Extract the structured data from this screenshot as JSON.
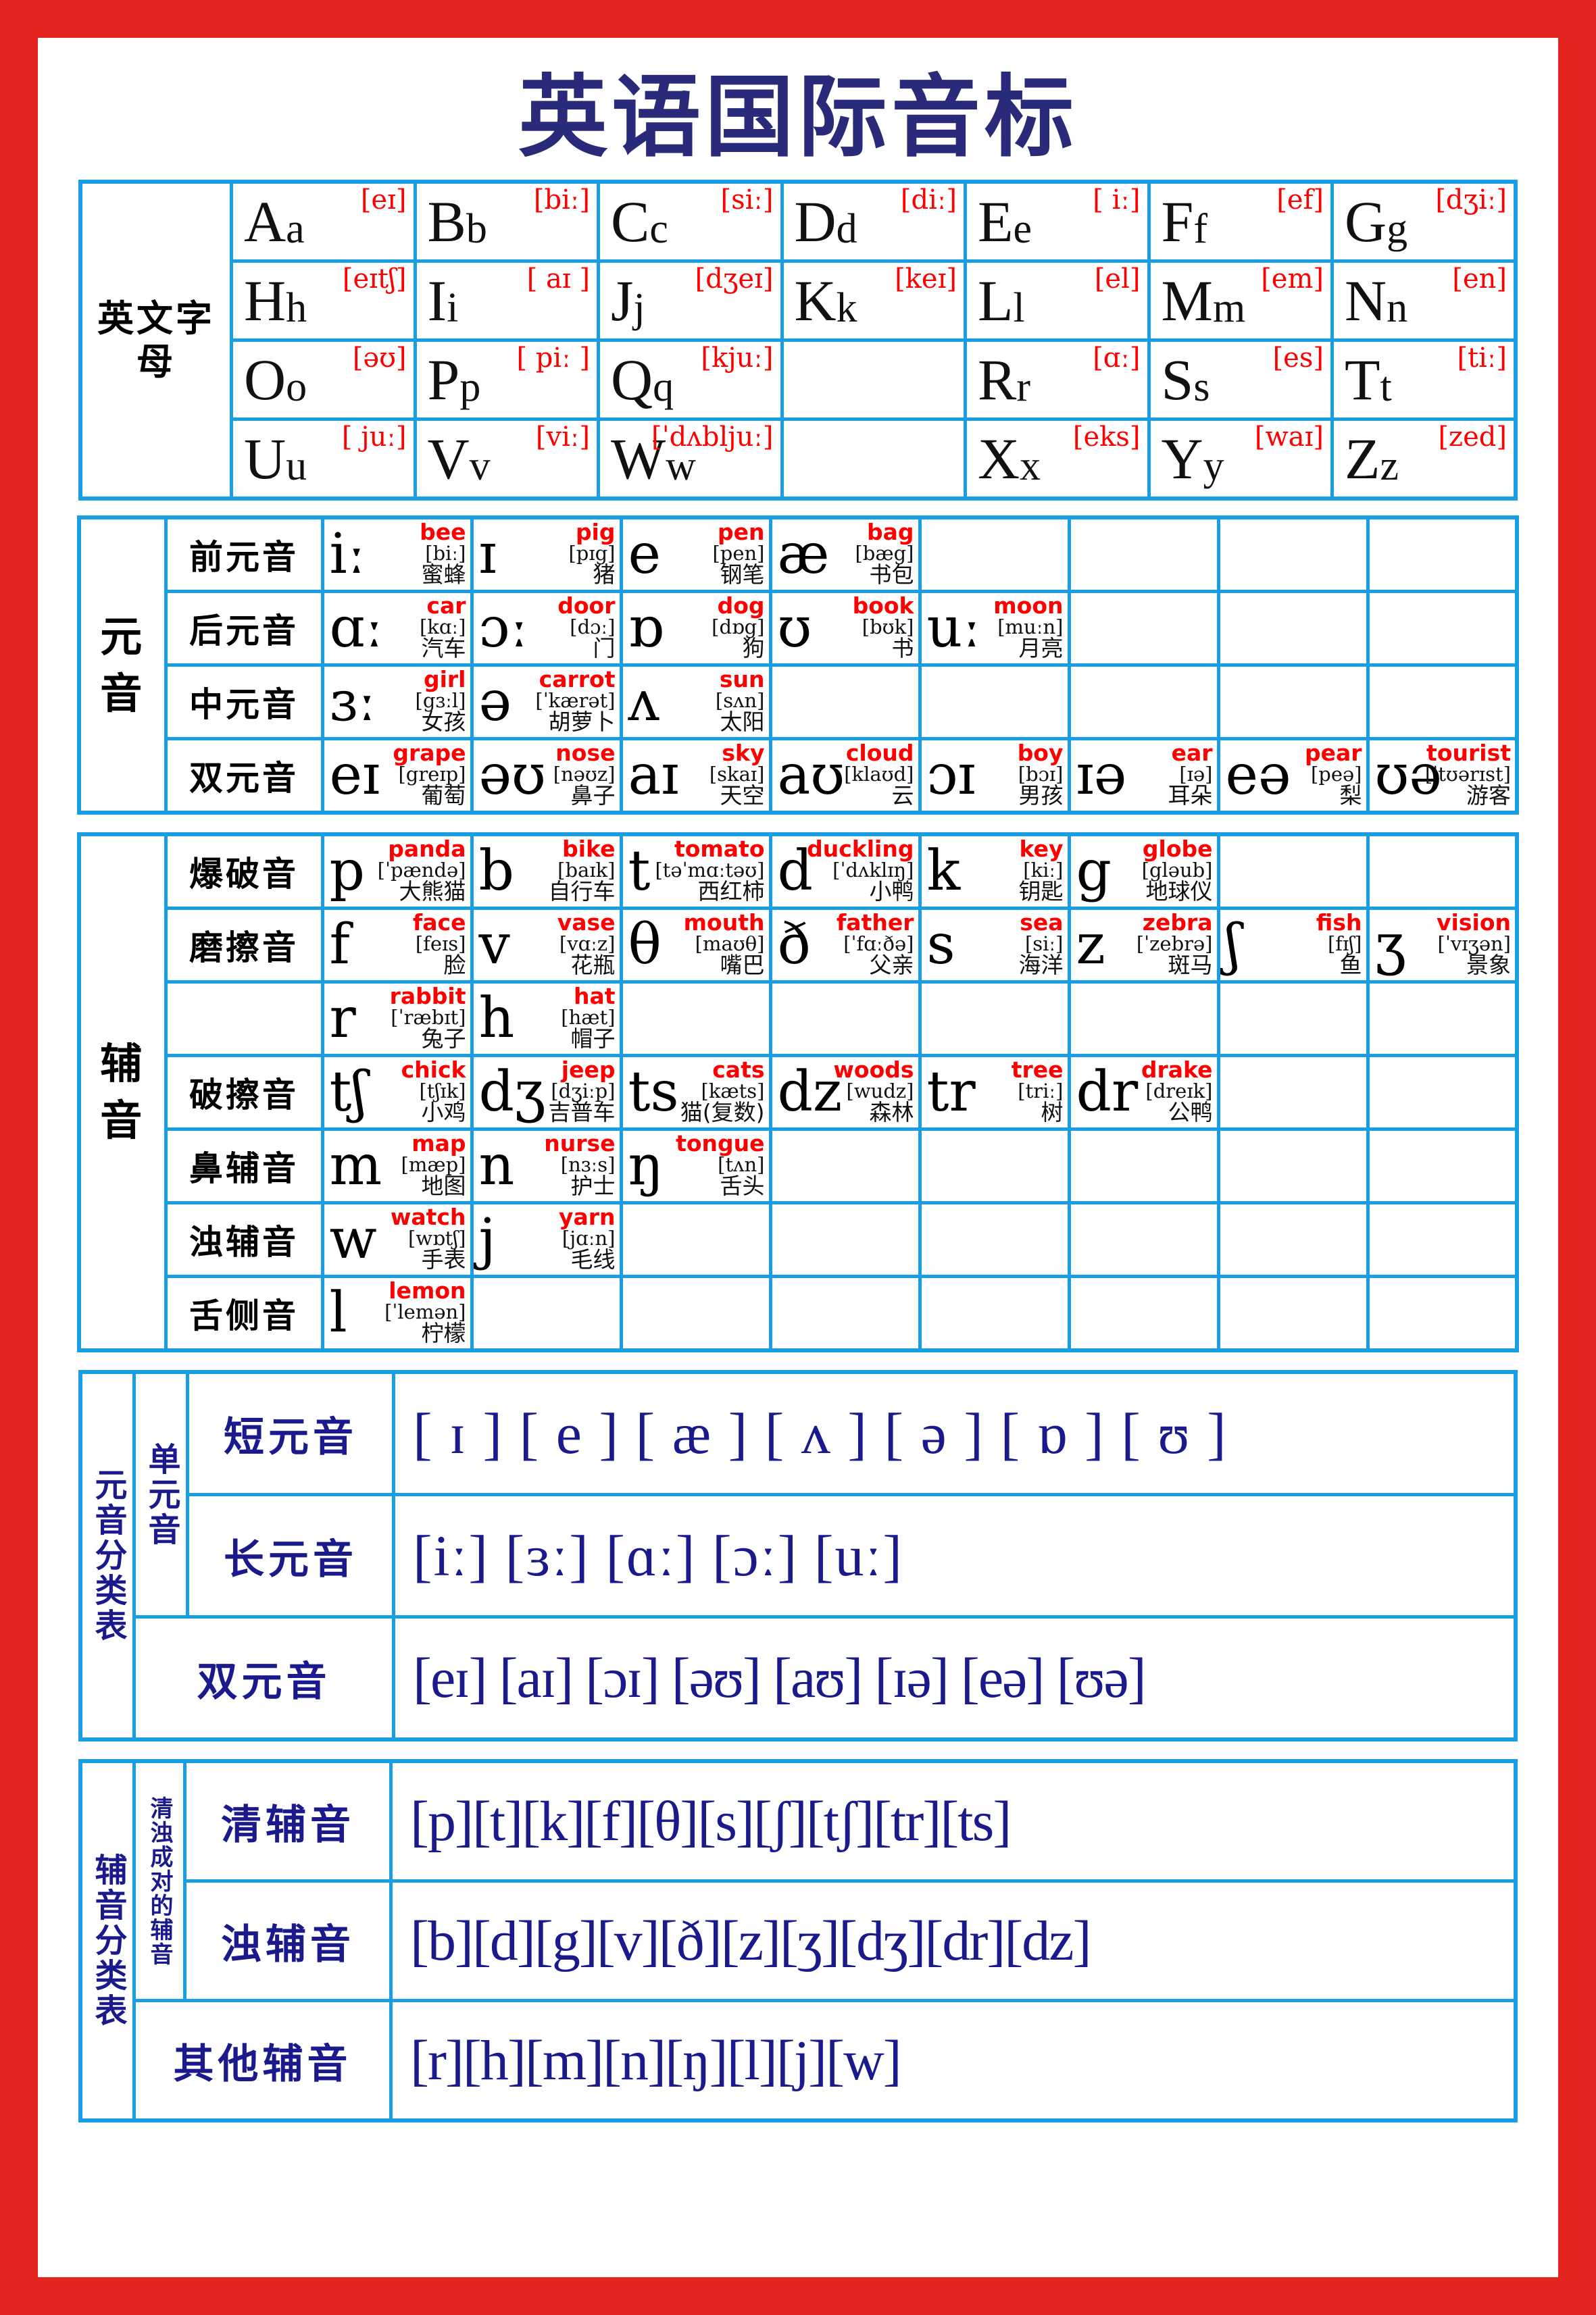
{
  "title": "英语国际音标",
  "alphabet": {
    "side_label": "英文字母",
    "rows": [
      [
        {
          "upper": "A",
          "lower": "a",
          "ipa": "[eɪ]"
        },
        {
          "upper": "B",
          "lower": "b",
          "ipa": "[biː]"
        },
        {
          "upper": "C",
          "lower": "c",
          "ipa": "[siː]"
        },
        {
          "upper": "D",
          "lower": "d",
          "ipa": "[diː]"
        },
        {
          "upper": "E",
          "lower": "e",
          "ipa": "[ iː]"
        },
        {
          "upper": "F",
          "lower": "f",
          "ipa": "[ef]"
        },
        {
          "upper": "G",
          "lower": "g",
          "ipa": "[dʒiː]"
        }
      ],
      [
        {
          "upper": "H",
          "lower": "h",
          "ipa": "[eɪtʃ]"
        },
        {
          "upper": "I",
          "lower": "i",
          "ipa": "[ aɪ ]"
        },
        {
          "upper": "J",
          "lower": "j",
          "ipa": "[dʒeɪ]"
        },
        {
          "upper": "K",
          "lower": "k",
          "ipa": "[keɪ]"
        },
        {
          "upper": "L",
          "lower": "l",
          "ipa": "[el]"
        },
        {
          "upper": "M",
          "lower": "m",
          "ipa": "[em]"
        },
        {
          "upper": "N",
          "lower": "n",
          "ipa": "[en]"
        }
      ],
      [
        {
          "upper": "O",
          "lower": "o",
          "ipa": "[əʊ]"
        },
        {
          "upper": "P",
          "lower": "p",
          "ipa": "[ piː ]"
        },
        {
          "upper": "Q",
          "lower": "q",
          "ipa": "[kjuː]"
        },
        {
          "upper": "",
          "lower": "",
          "ipa": ""
        },
        {
          "upper": "R",
          "lower": "r",
          "ipa": "[ɑː]"
        },
        {
          "upper": "S",
          "lower": "s",
          "ipa": "[es]"
        },
        {
          "upper": "T",
          "lower": "t",
          "ipa": "[tiː]"
        }
      ],
      [
        {
          "upper": "U",
          "lower": "u",
          "ipa": "[ juː]"
        },
        {
          "upper": "V",
          "lower": "v",
          "ipa": "[viː]"
        },
        {
          "upper": "W",
          "lower": "w",
          "ipa": "[ˈdʌbljuː]"
        },
        {
          "upper": "",
          "lower": "",
          "ipa": ""
        },
        {
          "upper": "X",
          "lower": "x",
          "ipa": "[eks]"
        },
        {
          "upper": "Y",
          "lower": "y",
          "ipa": "[waɪ]"
        },
        {
          "upper": "Z",
          "lower": "z",
          "ipa": "[zed]"
        }
      ]
    ]
  },
  "sounds": {
    "vowel_group_label": "元 音",
    "consonant_group_label": "辅 音",
    "vowel_rows": [
      {
        "label": "前元音",
        "cells": [
          {
            "ipa": "iː",
            "word": "bee",
            "phon": "[biː]",
            "cn": "蜜蜂"
          },
          {
            "ipa": "ɪ",
            "word": "pig",
            "phon": "[pɪg]",
            "cn": "猪"
          },
          {
            "ipa": "e",
            "word": "pen",
            "phon": "[pen]",
            "cn": "钢笔"
          },
          {
            "ipa": "æ",
            "word": "bag",
            "phon": "[bæg]",
            "cn": "书包"
          },
          {
            "ipa": "",
            "word": "",
            "phon": "",
            "cn": ""
          },
          {
            "ipa": "",
            "word": "",
            "phon": "",
            "cn": ""
          },
          {
            "ipa": "",
            "word": "",
            "phon": "",
            "cn": ""
          },
          {
            "ipa": "",
            "word": "",
            "phon": "",
            "cn": ""
          }
        ]
      },
      {
        "label": "后元音",
        "cells": [
          {
            "ipa": "ɑː",
            "word": "car",
            "phon": "[kɑː]",
            "cn": "汽车"
          },
          {
            "ipa": "ɔː",
            "word": "door",
            "phon": "[dɔː]",
            "cn": "门"
          },
          {
            "ipa": "ɒ",
            "word": "dog",
            "phon": "[dɒg]",
            "cn": "狗"
          },
          {
            "ipa": "ʊ",
            "word": "book",
            "phon": "[bʊk]",
            "cn": "书"
          },
          {
            "ipa": "uː",
            "word": "moon",
            "phon": "[muːn]",
            "cn": "月亮"
          },
          {
            "ipa": "",
            "word": "",
            "phon": "",
            "cn": ""
          },
          {
            "ipa": "",
            "word": "",
            "phon": "",
            "cn": ""
          },
          {
            "ipa": "",
            "word": "",
            "phon": "",
            "cn": ""
          }
        ]
      },
      {
        "label": "中元音",
        "cells": [
          {
            "ipa": "ɜː",
            "word": "girl",
            "phon": "[gɜːl]",
            "cn": "女孩"
          },
          {
            "ipa": "ə",
            "word": "carrot",
            "phon": "[ˈkærət]",
            "cn": "胡萝卜"
          },
          {
            "ipa": "ʌ",
            "word": "sun",
            "phon": "[sʌn]",
            "cn": "太阳"
          },
          {
            "ipa": "",
            "word": "",
            "phon": "",
            "cn": ""
          },
          {
            "ipa": "",
            "word": "",
            "phon": "",
            "cn": ""
          },
          {
            "ipa": "",
            "word": "",
            "phon": "",
            "cn": ""
          },
          {
            "ipa": "",
            "word": "",
            "phon": "",
            "cn": ""
          },
          {
            "ipa": "",
            "word": "",
            "phon": "",
            "cn": ""
          }
        ]
      },
      {
        "label": "双元音",
        "cells": [
          {
            "ipa": "eɪ",
            "word": "grape",
            "phon": "[greɪp]",
            "cn": "葡萄"
          },
          {
            "ipa": "əʊ",
            "word": "nose",
            "phon": "[nəʊz]",
            "cn": "鼻子"
          },
          {
            "ipa": "aɪ",
            "word": "sky",
            "phon": "[skaɪ]",
            "cn": "天空"
          },
          {
            "ipa": "aʊ",
            "word": "cloud",
            "phon": "[klaʊd]",
            "cn": "云"
          },
          {
            "ipa": "ɔɪ",
            "word": "boy",
            "phon": "[bɔɪ]",
            "cn": "男孩"
          },
          {
            "ipa": "ɪə",
            "word": "ear",
            "phon": "[ɪə]",
            "cn": "耳朵"
          },
          {
            "ipa": "eə",
            "word": "pear",
            "phon": "[peə]",
            "cn": "梨"
          },
          {
            "ipa": "ʊə",
            "word": "tourist",
            "phon": "[ˈtʊərɪst]",
            "cn": "游客"
          }
        ]
      }
    ],
    "consonant_rows": [
      {
        "label": "爆破音",
        "cells": [
          {
            "ipa": "p",
            "word": "panda",
            "phon": "[ˈpændə]",
            "cn": "大熊猫"
          },
          {
            "ipa": "b",
            "word": "bike",
            "phon": "[baɪk]",
            "cn": "自行车"
          },
          {
            "ipa": "t",
            "word": "tomato",
            "phon": "[təˈmɑːtəʊ]",
            "cn": "西红柿"
          },
          {
            "ipa": "d",
            "word": "duckling",
            "phon": "[ˈdʌklɪŋ]",
            "cn": "小鸭"
          },
          {
            "ipa": "k",
            "word": "key",
            "phon": "[kiː]",
            "cn": "钥匙"
          },
          {
            "ipa": "g",
            "word": "globe",
            "phon": "[gləub]",
            "cn": "地球仪"
          },
          {
            "ipa": "",
            "word": "",
            "phon": "",
            "cn": ""
          },
          {
            "ipa": "",
            "word": "",
            "phon": "",
            "cn": ""
          }
        ]
      },
      {
        "label": "磨擦音",
        "cells": [
          {
            "ipa": "f",
            "word": "face",
            "phon": "[feɪs]",
            "cn": "脸"
          },
          {
            "ipa": "v",
            "word": "vase",
            "phon": "[vɑːz]",
            "cn": "花瓶"
          },
          {
            "ipa": "θ",
            "word": "mouth",
            "phon": "[maʊθ]",
            "cn": "嘴巴"
          },
          {
            "ipa": "ð",
            "word": "father",
            "phon": "[ˈfɑːðə]",
            "cn": "父亲"
          },
          {
            "ipa": "s",
            "word": "sea",
            "phon": "[siː]",
            "cn": "海洋"
          },
          {
            "ipa": "z",
            "word": "zebra",
            "phon": "[ˈzebrə]",
            "cn": "斑马"
          },
          {
            "ipa": "ʃ",
            "word": "fish",
            "phon": "[fɪʃ]",
            "cn": "鱼"
          },
          {
            "ipa": "ʒ",
            "word": "vision",
            "phon": "[ˈvɪʒən]",
            "cn": "景象"
          }
        ]
      },
      {
        "label": "",
        "cells": [
          {
            "ipa": "r",
            "word": "rabbit",
            "phon": "[ˈræbɪt]",
            "cn": "兔子"
          },
          {
            "ipa": "h",
            "word": "hat",
            "phon": "[hæt]",
            "cn": "帽子"
          },
          {
            "ipa": "",
            "word": "",
            "phon": "",
            "cn": ""
          },
          {
            "ipa": "",
            "word": "",
            "phon": "",
            "cn": ""
          },
          {
            "ipa": "",
            "word": "",
            "phon": "",
            "cn": ""
          },
          {
            "ipa": "",
            "word": "",
            "phon": "",
            "cn": ""
          },
          {
            "ipa": "",
            "word": "",
            "phon": "",
            "cn": ""
          },
          {
            "ipa": "",
            "word": "",
            "phon": "",
            "cn": ""
          }
        ]
      },
      {
        "label": "破擦音",
        "cells": [
          {
            "ipa": "tʃ",
            "word": "chick",
            "phon": "[tʃɪk]",
            "cn": "小鸡"
          },
          {
            "ipa": "dʒ",
            "word": "jeep",
            "phon": "[dʒiːp]",
            "cn": "吉普车"
          },
          {
            "ipa": "ts",
            "word": "cats",
            "phon": "[kæts]",
            "cn": "猫(复数)"
          },
          {
            "ipa": "dz",
            "word": "woods",
            "phon": "[wudz]",
            "cn": "森林"
          },
          {
            "ipa": "tr",
            "word": "tree",
            "phon": "[triː]",
            "cn": "树"
          },
          {
            "ipa": "dr",
            "word": "drake",
            "phon": "[dreɪk]",
            "cn": "公鸭"
          },
          {
            "ipa": "",
            "word": "",
            "phon": "",
            "cn": ""
          },
          {
            "ipa": "",
            "word": "",
            "phon": "",
            "cn": ""
          }
        ]
      },
      {
        "label": "鼻辅音",
        "cells": [
          {
            "ipa": "m",
            "word": "map",
            "phon": "[mæp]",
            "cn": "地图"
          },
          {
            "ipa": "n",
            "word": "nurse",
            "phon": "[nɜːs]",
            "cn": "护士"
          },
          {
            "ipa": "ŋ",
            "word": "tongue",
            "phon": "[tʌn]",
            "cn": "舌头"
          },
          {
            "ipa": "",
            "word": "",
            "phon": "",
            "cn": ""
          },
          {
            "ipa": "",
            "word": "",
            "phon": "",
            "cn": ""
          },
          {
            "ipa": "",
            "word": "",
            "phon": "",
            "cn": ""
          },
          {
            "ipa": "",
            "word": "",
            "phon": "",
            "cn": ""
          },
          {
            "ipa": "",
            "word": "",
            "phon": "",
            "cn": ""
          }
        ]
      },
      {
        "label": "浊辅音",
        "cells": [
          {
            "ipa": "w",
            "word": "watch",
            "phon": "[wɒtʃ]",
            "cn": "手表"
          },
          {
            "ipa": "j",
            "word": "yarn",
            "phon": "[jɑːn]",
            "cn": "毛线"
          },
          {
            "ipa": "",
            "word": "",
            "phon": "",
            "cn": ""
          },
          {
            "ipa": "",
            "word": "",
            "phon": "",
            "cn": ""
          },
          {
            "ipa": "",
            "word": "",
            "phon": "",
            "cn": ""
          },
          {
            "ipa": "",
            "word": "",
            "phon": "",
            "cn": ""
          },
          {
            "ipa": "",
            "word": "",
            "phon": "",
            "cn": ""
          },
          {
            "ipa": "",
            "word": "",
            "phon": "",
            "cn": ""
          }
        ]
      },
      {
        "label": "舌侧音",
        "cells": [
          {
            "ipa": "l",
            "word": "lemon",
            "phon": "[ˈlemən]",
            "cn": "柠檬"
          },
          {
            "ipa": "",
            "word": "",
            "phon": "",
            "cn": ""
          },
          {
            "ipa": "",
            "word": "",
            "phon": "",
            "cn": ""
          },
          {
            "ipa": "",
            "word": "",
            "phon": "",
            "cn": ""
          },
          {
            "ipa": "",
            "word": "",
            "phon": "",
            "cn": ""
          },
          {
            "ipa": "",
            "word": "",
            "phon": "",
            "cn": ""
          },
          {
            "ipa": "",
            "word": "",
            "phon": "",
            "cn": ""
          },
          {
            "ipa": "",
            "word": "",
            "phon": "",
            "cn": ""
          }
        ]
      }
    ]
  },
  "vowel_classification": {
    "title": "元音分类表",
    "mono_label": "单元音",
    "short_label": "短元音",
    "short_list": "[ ɪ ] [ e ] [ æ ] [ ʌ ] [ ə ] [ ɒ ] [ ʊ ]",
    "long_label": "长元音",
    "long_list": "[iː] [ɜː] [ɑː] [ɔː] [uː]",
    "diph_label": "双元音",
    "diph_list": "[eɪ] [aɪ] [ɔɪ] [əʊ] [aʊ] [ɪə] [eə] [ʊə]"
  },
  "consonant_classification": {
    "title": "辅音分类表",
    "pair_label": "清浊成对的辅音",
    "voiceless_label": "清辅音",
    "voiceless_list": "[p][t][k][f][θ][s][ʃ][tʃ][tr][ts]",
    "voiced_label": "浊辅音",
    "voiced_list": "[b][d][g][v][ð][z][ʒ][dʒ][dr][dz]",
    "other_label": "其他辅音",
    "other_list": "[r][h][m][n][ŋ][l][j][w]"
  },
  "colors": {
    "frame": "#e3231e",
    "grid": "#1a9ee3",
    "title": "#2a2a7a",
    "word": "#ff0000",
    "classification": "#1a1a8c"
  }
}
